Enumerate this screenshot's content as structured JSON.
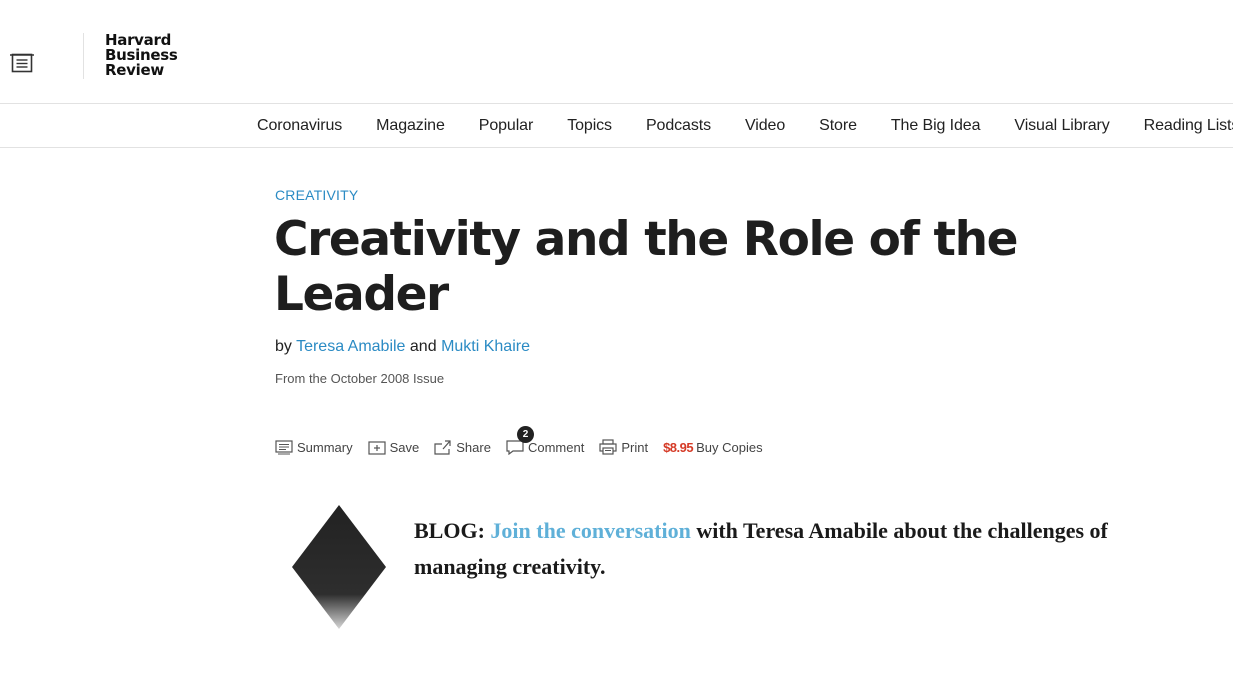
{
  "header": {
    "logo_lines": [
      "Harvard",
      "Business",
      "Review"
    ]
  },
  "nav": {
    "items": [
      "Coronavirus",
      "Magazine",
      "Popular",
      "Topics",
      "Podcasts",
      "Video",
      "Store",
      "The Big Idea",
      "Visual Library",
      "Reading Lists"
    ]
  },
  "article": {
    "topic": "CREATIVITY",
    "title": "Creativity and the Role of the Leader",
    "byline": {
      "prefix": "by",
      "author1": "Teresa Amabile",
      "joiner": "and",
      "author2": "Mukti Khaire"
    },
    "issue": "From the October 2008 Issue"
  },
  "tools": {
    "summary": "Summary",
    "save": "Save",
    "share": "Share",
    "comment": "Comment",
    "comment_count": "2",
    "print": "Print",
    "price": "$8.95",
    "buy": "Buy Copies"
  },
  "callout": {
    "lead": "BLOG:",
    "link": "Join the conversation",
    "rest": "with Teresa Amabile about the challenges of managing creativity."
  },
  "colors": {
    "link": "#2b8bc4",
    "price": "#d53a26",
    "callout_link": "#5fb0d8"
  },
  "icons": [
    "menu-icon",
    "summary-icon",
    "save-icon",
    "share-icon",
    "comment-icon",
    "print-icon",
    "diamond-icon"
  ]
}
